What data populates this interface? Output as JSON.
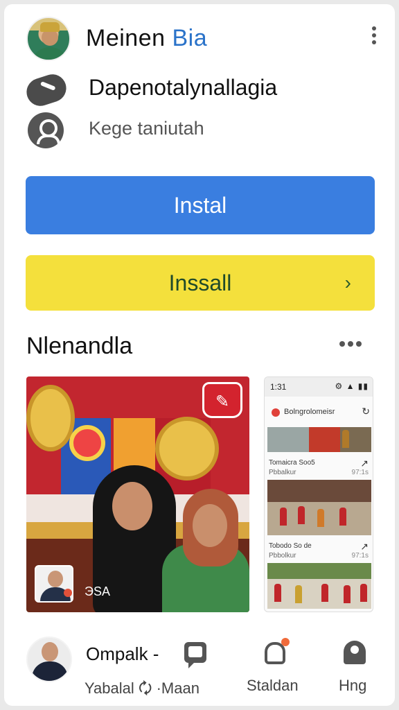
{
  "header": {
    "title_part1": "Meinen",
    "title_part2": "Bia",
    "avatar_icon": "profile-avatar",
    "menu_icon": "more-vert-icon"
  },
  "details": {
    "line1": "Dapenotalynallagia",
    "line1_icon": "phone-icon",
    "line2": "Kege tanіutah",
    "line2_icon": "person-icon"
  },
  "buttons": {
    "primary_label": "Instal",
    "secondary_label": "Inssall",
    "secondary_chevron": "›",
    "primary_color": "#3a7ee0",
    "secondary_color": "#f4e03c"
  },
  "section": {
    "title": "Nlenandla",
    "more_icon": "more-horiz-icon"
  },
  "media": {
    "caption": "ЭSA",
    "sticker_glyph": "✎"
  },
  "phone_preview": {
    "time": "1:31",
    "status_icons": "⚙ ▲ ▮▮",
    "app_name": "Bolngrolomeisr",
    "refresh_glyph": "↻",
    "item1_title": "Tomaicra Soo5",
    "item1_sub": "Pbbalkur",
    "item1_meta": "97:1s",
    "item2_title": "Tobodо So de",
    "item2_sub": "Pbbolkur",
    "item2_meta": "97:1s",
    "share_glyph": "↗"
  },
  "bottom": {
    "name": "Ompalk -",
    "sub": "Yabalal 🗘 ·Maan",
    "nav2_label": "Staldan",
    "nav3_label": "Hng"
  }
}
